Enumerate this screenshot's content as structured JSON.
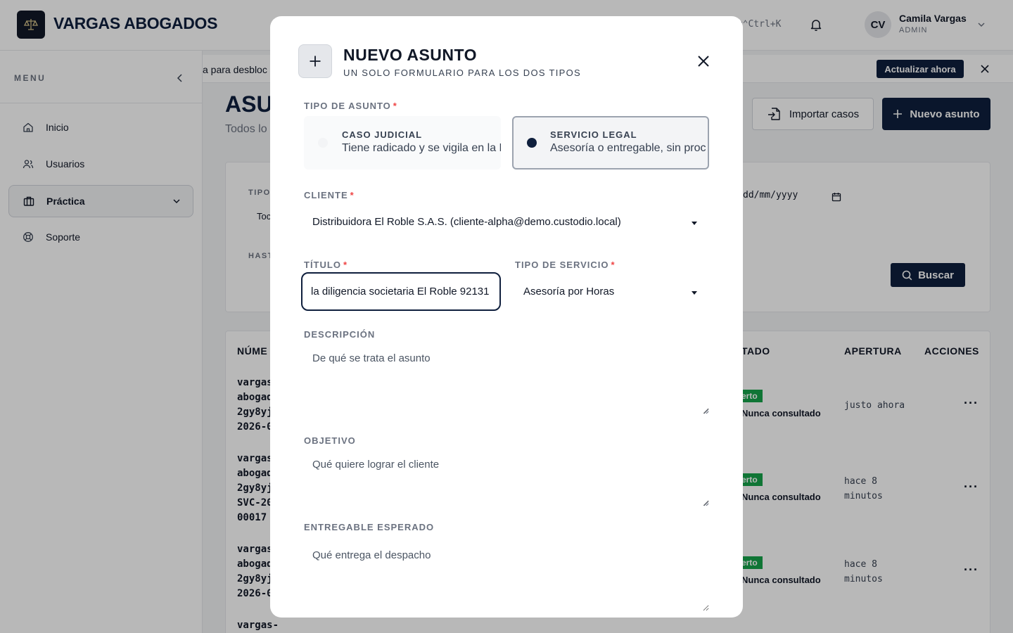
{
  "header": {
    "brand": "VARGAS ABOGADOS",
    "search_hint": "um⌃Ctrl+K",
    "user_initials": "CV",
    "user_name": "Camila Vargas",
    "user_role": "ADMIN"
  },
  "sidebar": {
    "title": "MENU",
    "items": [
      {
        "label": "Inicio",
        "icon": "home-icon"
      },
      {
        "label": "Usuarios",
        "icon": "users-icon"
      },
      {
        "label": "Práctica",
        "icon": "briefcase-icon",
        "active": true
      },
      {
        "label": "Soporte",
        "icon": "lifebuoy-icon"
      }
    ]
  },
  "banner": {
    "text": "a para desbloc",
    "button": "Actualizar ahora"
  },
  "page": {
    "title": "ASU",
    "subtitle": "Todos lo",
    "import_button": "Importar casos",
    "new_button": "Nuevo asunto"
  },
  "filters": {
    "tipo_label": "TIPO",
    "tipo_value": "Toc",
    "hasta_label": "HAST",
    "date_placeholder": "dd/mm/yyyy",
    "search_button": "Buscar"
  },
  "table": {
    "headers": {
      "numero": "NÚME",
      "estado": "TADO",
      "apertura": "APERTURA",
      "acciones": "ACCIONES"
    },
    "rows": [
      {
        "numero": "vargas\nabogad\n2gy8yj\n2026-0",
        "badge": "erto",
        "seen": "Nunca consultado",
        "opened": "justo ahora"
      },
      {
        "numero": "vargas\nabogad\n2gy8yj\nSVC-20\n00017",
        "badge": "erto",
        "seen": "Nunca consultado",
        "opened": "hace 8\nminutos"
      },
      {
        "numero": "vargas\nabogad\n2gy8yj\n2026-0",
        "badge": "erto",
        "seen": "Nunca consultado",
        "opened": "hace 8\nminutos"
      },
      {
        "numero": "vargas-",
        "badge": "",
        "seen": "",
        "opened": ""
      }
    ],
    "dots": "···"
  },
  "modal": {
    "title": "NUEVO ASUNTO",
    "subtitle": "UN SOLO FORMULARIO PARA LOS DOS TIPOS",
    "tipo_label": "TIPO DE ASUNTO",
    "options": [
      {
        "name": "CASO JUDICIAL",
        "desc": "Tiene radicado y se vigila en la Rama Judicial",
        "selected": false
      },
      {
        "name": "SERVICIO LEGAL",
        "desc": "Asesoría o entregable, sin proc",
        "selected": true
      }
    ],
    "cliente_label": "CLIENTE",
    "cliente_value": "Distribuidora El Roble S.A.S. (cliente-alpha@demo.custodio.local)",
    "titulo_label": "TÍTULO",
    "titulo_value": "la diligencia societaria El Roble 92131",
    "servicio_label": "TIPO DE SERVICIO",
    "servicio_value": "Asesoría por Horas",
    "descripcion_label": "DESCRIPCIÓN",
    "descripcion_placeholder": "De qué se trata el asunto",
    "objetivo_label": "OBJETIVO",
    "objetivo_placeholder": "Qué quiere lograr el cliente",
    "entregable_label": "ENTREGABLE ESPERADO",
    "entregable_placeholder": "Qué entrega el despacho",
    "required_mark": "*"
  },
  "colors": {
    "brand_navy": "#0f1f3d",
    "status_green": "#16a34a",
    "required_red": "#ef4444"
  }
}
